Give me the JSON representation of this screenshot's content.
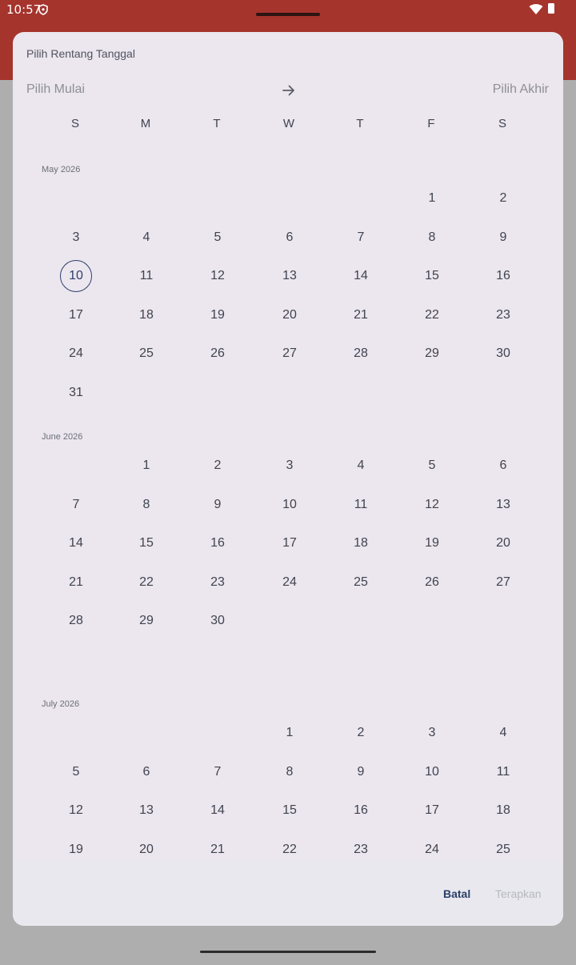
{
  "status_bar": {
    "time": "10:57",
    "bg_color": "#a5342d",
    "icons": [
      "shield-icon",
      "wifi-icon",
      "battery-icon"
    ]
  },
  "dialog": {
    "title": "Pilih Rentang Tanggal",
    "start_placeholder": "Pilih Mulai",
    "end_placeholder": "Pilih Akhir",
    "arrow_icon": "arrow-right-icon",
    "bg_color": "#ece6ee",
    "weekdays": [
      "S",
      "M",
      "T",
      "W",
      "T",
      "F",
      "S"
    ],
    "today": "May 10 2026",
    "months": [
      {
        "label": "May 2026",
        "first_weekday": 5,
        "days": 31
      },
      {
        "label": "June 2026",
        "first_weekday": 1,
        "days": 30
      },
      {
        "label": "July 2026",
        "first_weekday": 3,
        "days": 31
      }
    ],
    "cancel_label": "Batal",
    "apply_label": "Terapkan",
    "apply_enabled": false,
    "accent_color": "#2d3f6e"
  }
}
